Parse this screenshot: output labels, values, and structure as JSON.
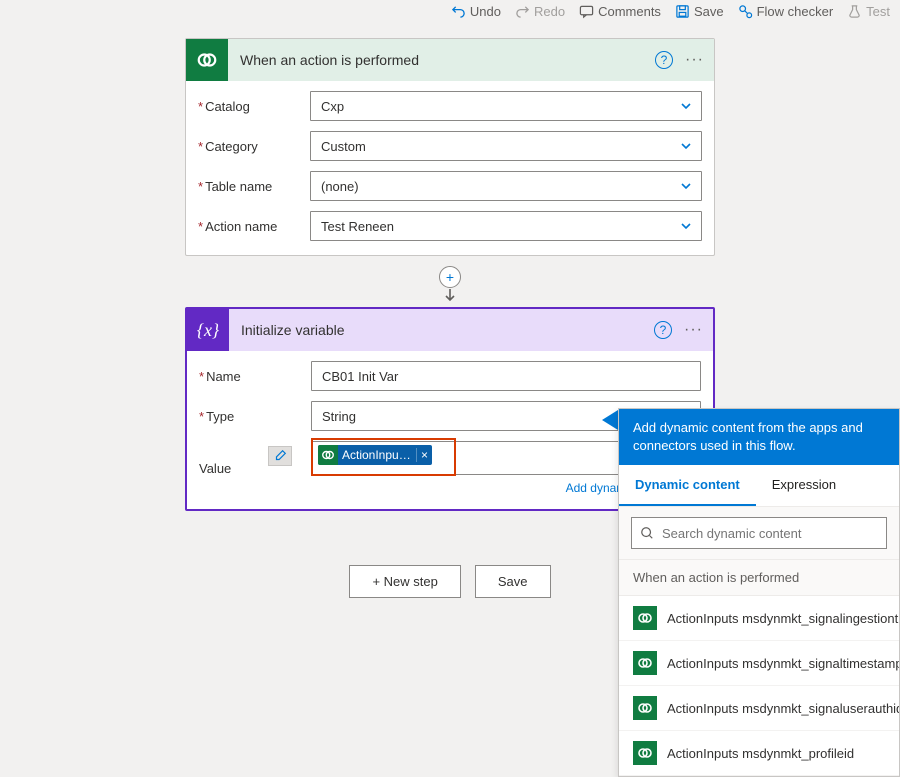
{
  "toolbar": {
    "undo": "Undo",
    "redo": "Redo",
    "comments": "Comments",
    "save": "Save",
    "checker": "Flow checker",
    "test": "Test"
  },
  "trigger": {
    "title": "When an action is performed",
    "fields": {
      "catalog_label": "Catalog",
      "catalog_value": "Cxp",
      "category_label": "Category",
      "category_value": "Custom",
      "table_label": "Table name",
      "table_value": "(none)",
      "action_label": "Action name",
      "action_value": "Test Reneen"
    }
  },
  "action": {
    "title": "Initialize variable",
    "name_label": "Name",
    "name_value": "CB01 Init Var",
    "type_label": "Type",
    "type_value": "String",
    "value_label": "Value",
    "token_text": "ActionInputs m...",
    "add_dynamic": "Add dynamic content"
  },
  "buttons": {
    "newstep": "+ New step",
    "save": "Save"
  },
  "panel": {
    "header": "Add dynamic content from the apps and connectors used in this flow.",
    "tab_dc": "Dynamic content",
    "tab_ex": "Expression",
    "search_placeholder": "Search dynamic content",
    "section": "When an action is performed",
    "items": [
      "ActionInputs msdynmkt_signalingestiontimestamp",
      "ActionInputs msdynmkt_signaltimestamp",
      "ActionInputs msdynmkt_signaluserauthid",
      "ActionInputs msdynmkt_profileid"
    ]
  }
}
